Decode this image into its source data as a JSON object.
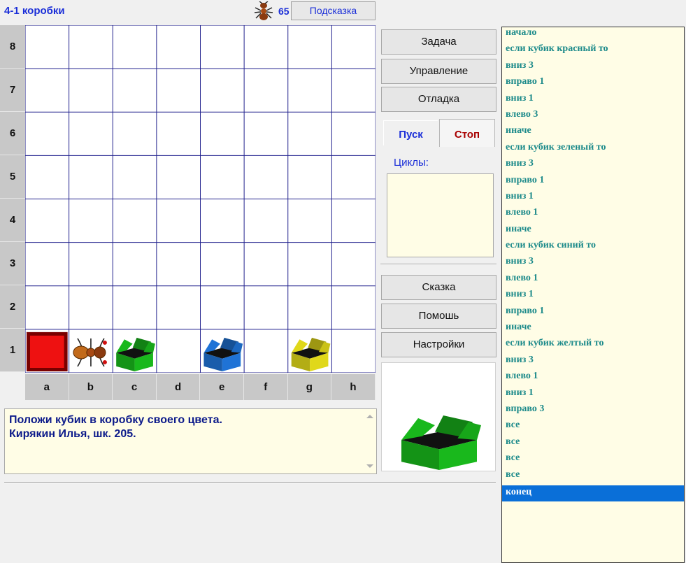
{
  "title": "4-1 коробки",
  "ant_count": "65",
  "hint_button": "Подсказка",
  "board": {
    "rows": [
      "8",
      "7",
      "6",
      "5",
      "4",
      "3",
      "2",
      "1"
    ],
    "cols": [
      "a",
      "b",
      "c",
      "d",
      "e",
      "f",
      "g",
      "h"
    ],
    "cube": {
      "cell": "a1",
      "color": "#ee1111"
    },
    "robot_cell": "b1",
    "boxes": [
      {
        "cell": "c1",
        "color": "#19b81c"
      },
      {
        "cell": "e1",
        "color": "#1f73d6"
      },
      {
        "cell": "g1",
        "color": "#e0d81a"
      }
    ]
  },
  "buttons": {
    "task": "Задача",
    "control": "Управление",
    "debug": "Отладка",
    "run": "Пуск",
    "stop": "Стоп",
    "cycles_label": "Циклы:",
    "tale": "Сказка",
    "help": "Помошь",
    "settings": "Настройки"
  },
  "message": {
    "line1": "Положи кубик в коробку своего цвета.",
    "line2": "Кирякин Илья, шк. 205."
  },
  "preview_box_color": "#19b81c",
  "program": [
    "начало",
    "если кубик красный то",
    "вниз 3",
    "вправо 1",
    "вниз 1",
    "влево 3",
    "иначе",
    "если кубик зеленый то",
    "вниз 3",
    "вправо 1",
    "вниз 1",
    "влево 1",
    "иначе",
    "если кубик синий то",
    "вниз 3",
    "влево 1",
    "вниз 1",
    "вправо 1",
    "иначе",
    "если кубик желтый то",
    "вниз 3",
    "влево 1",
    "вниз 1",
    "вправо 3",
    "все",
    "все",
    "все",
    "все",
    "конец"
  ],
  "selected_line": 28
}
